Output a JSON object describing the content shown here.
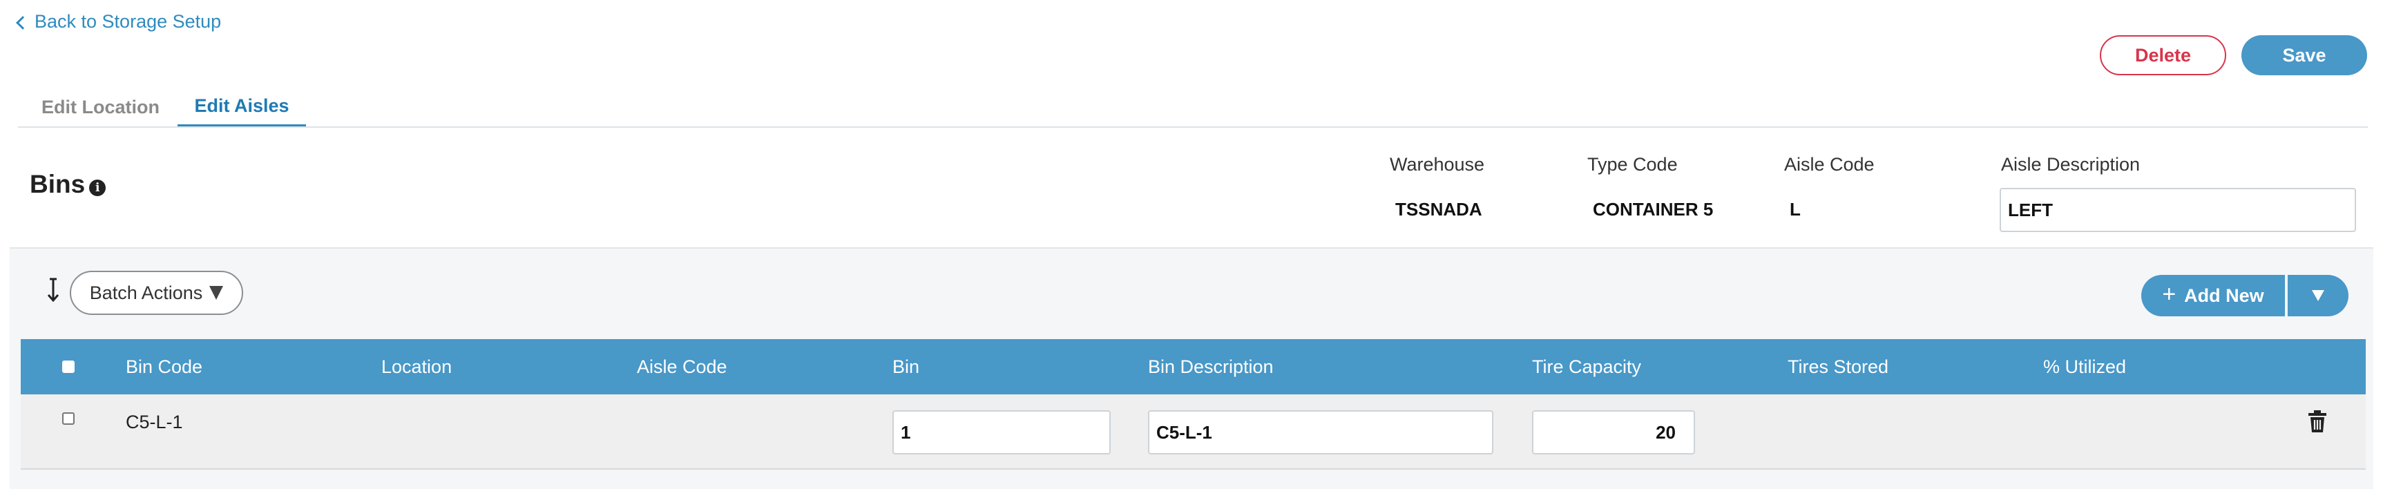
{
  "nav": {
    "back_label": "Back to Storage Setup"
  },
  "actions": {
    "delete_label": "Delete",
    "save_label": "Save"
  },
  "tabs": [
    {
      "label": "Edit Location",
      "active": false
    },
    {
      "label": "Edit Aisles",
      "active": true
    }
  ],
  "section": {
    "title": "Bins",
    "info_icon": "info-icon"
  },
  "meta": {
    "warehouse_label": "Warehouse",
    "warehouse_value": "TSSNADA",
    "type_code_label": "Type Code",
    "type_code_value": "CONTAINER 5",
    "aisle_code_label": "Aisle Code",
    "aisle_code_value": "L",
    "aisle_description_label": "Aisle Description",
    "aisle_description_value": "LEFT"
  },
  "toolbar": {
    "sort_icon": "sort-arrow-icon",
    "batch_actions_label": "Batch Actions",
    "add_new_label": "Add New"
  },
  "table": {
    "columns": [
      "Bin Code",
      "Location",
      "Aisle Code",
      "Bin",
      "Bin Description",
      "Tire Capacity",
      "Tires Stored",
      "% Utilized"
    ],
    "rows": [
      {
        "bin_code": "C5-L-1",
        "location": "",
        "aisle_code": "",
        "bin": "1",
        "bin_description": "C5-L-1",
        "tire_capacity": "20",
        "tires_stored": "",
        "utilized": ""
      }
    ]
  },
  "colors": {
    "accent": "#4898c8",
    "danger": "#d8344b",
    "link": "#2f8bbf"
  }
}
